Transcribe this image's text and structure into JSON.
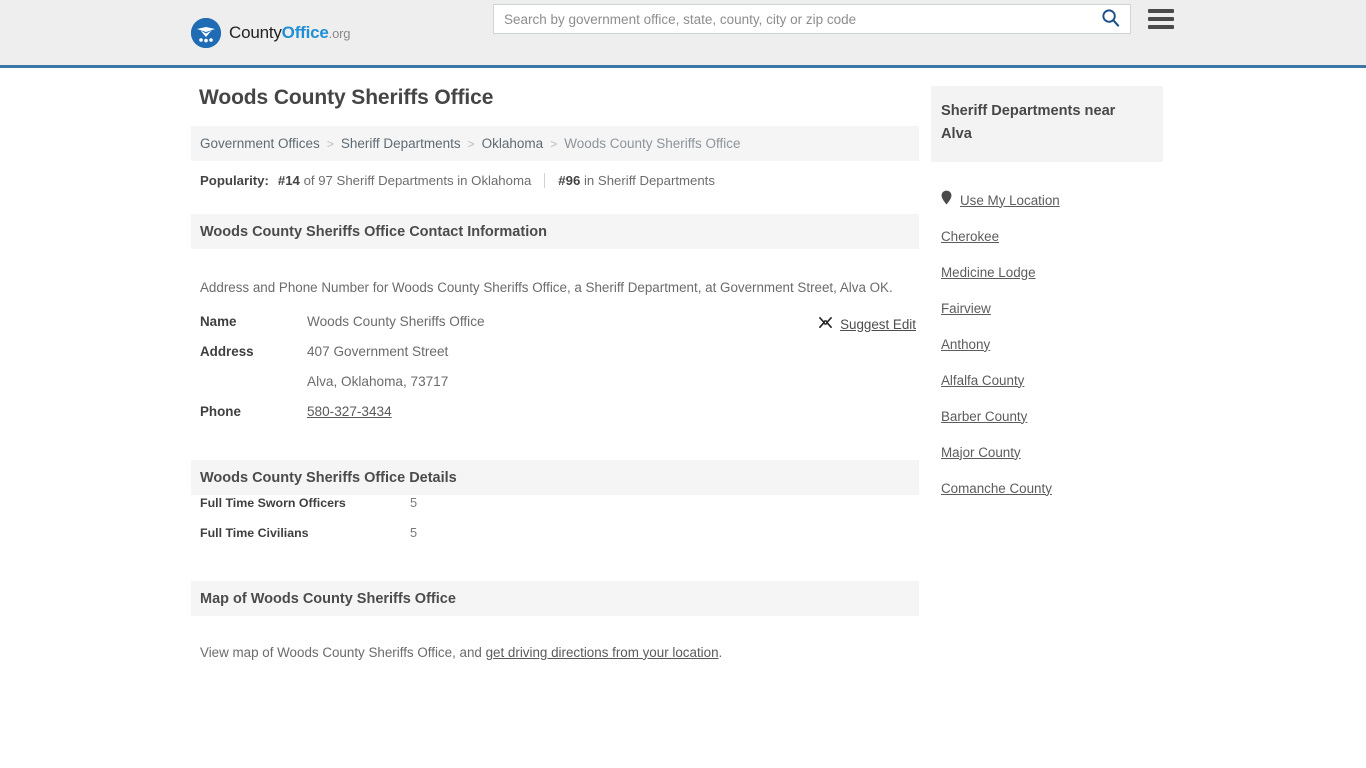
{
  "header": {
    "brand": {
      "part1": "County",
      "part2": "Office",
      "part3": ".org",
      "logo_icon": "eagle-shield-logo"
    },
    "search": {
      "placeholder": "Search by government office, state, county, city or zip code",
      "value": "",
      "search_icon": "search-icon"
    },
    "menu_icon": "hamburger-menu-icon",
    "accent_color": "#3c77a8"
  },
  "main": {
    "title": "Woods County Sheriffs Office",
    "breadcrumb": [
      {
        "label": "Government Offices",
        "current": false
      },
      {
        "label": "Sheriff Departments",
        "current": false
      },
      {
        "label": "Oklahoma",
        "current": false
      },
      {
        "label": "Woods County Sheriffs Office",
        "current": true
      }
    ],
    "breadcrumb_separator": ">",
    "popularity": {
      "label": "Popularity:",
      "rank_state": "#14",
      "rank_state_text": "of 97 Sheriff Departments in Oklahoma",
      "rank_all": "#96",
      "rank_all_text": "in Sheriff Departments"
    },
    "contact": {
      "heading": "Woods County Sheriffs Office Contact Information",
      "lead": "Address and Phone Number for Woods County Sheriffs Office, a Sheriff Department, at Government Street, Alva OK.",
      "suggest_edit": {
        "label": "Suggest Edit",
        "icon": "edit-pencil-icon"
      },
      "rows": [
        {
          "key": "Name",
          "value": "Woods County Sheriffs Office",
          "link": false
        },
        {
          "key": "Address",
          "value": "407 Government Street",
          "link": false
        },
        {
          "key": "",
          "value": "Alva, Oklahoma, 73717",
          "link": false
        },
        {
          "key": "Phone",
          "value": "580-327-3434",
          "link": true
        }
      ]
    },
    "details": {
      "heading": "Woods County Sheriffs Office Details",
      "rows": [
        {
          "key": "Full Time Sworn Officers",
          "value": "5"
        },
        {
          "key": "Full Time Civilians",
          "value": "5"
        }
      ]
    },
    "map": {
      "heading": "Map of Woods County Sheriffs Office",
      "note_before": "View map of Woods County Sheriffs Office, and ",
      "note_link": "get driving directions from your location",
      "note_after": "."
    }
  },
  "sidebar": {
    "heading": "Sheriff Departments near Alva",
    "use_my_location": {
      "label": "Use My Location",
      "icon": "map-pin-icon"
    },
    "links": [
      {
        "label": "Cherokee"
      },
      {
        "label": "Medicine Lodge"
      },
      {
        "label": "Fairview"
      },
      {
        "label": "Anthony"
      },
      {
        "label": "Alfalfa County"
      },
      {
        "label": "Barber County"
      },
      {
        "label": "Major County"
      },
      {
        "label": "Comanche County"
      }
    ]
  }
}
